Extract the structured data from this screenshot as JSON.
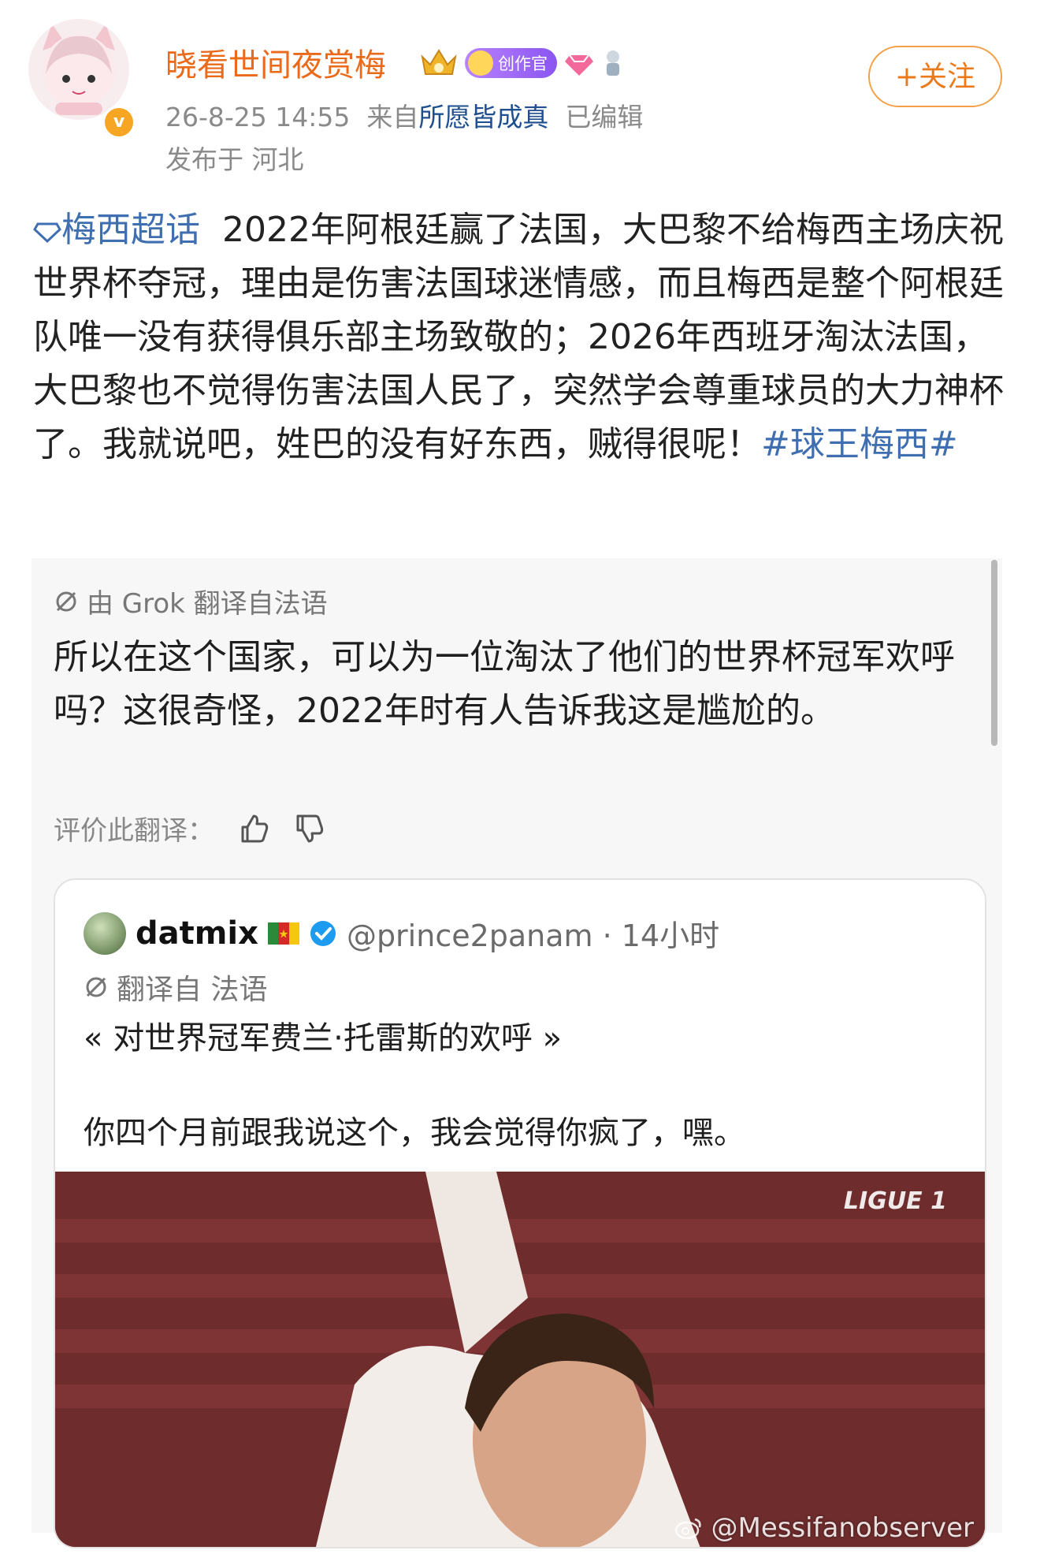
{
  "user": {
    "name": "晓看世间夜赏梅",
    "creator_badge": "创作官",
    "timestamp": "26-8-25 14:55",
    "source_prefix": "来自",
    "source": "所愿皆成真",
    "edited": "已编辑",
    "location": "发布于 河北"
  },
  "follow_button": "+关注",
  "post": {
    "topic": "梅西超话",
    "text": "2022年阿根廷赢了法国，大巴黎不给梅西主场庆祝世界杯夺冠，理由是伤害法国球迷情感，而且梅西是整个阿根廷队唯一没有获得俱乐部主场致敬的；2026年西班牙淘汰法国，大巴黎也不觉得伤害法国人民了，突然学会尊重球员的大力神杯了。我就说吧，姓巴的没有好东西，贼得很呢！",
    "hashtag": "#球王梅西#"
  },
  "translation": {
    "label": "由 Grok 翻译自法语",
    "text": "所以在这个国家，可以为一位淘汰了他们的世界杯冠军欢呼吗？这很奇怪，2022年时有人告诉我这是尴尬的。",
    "rate_label": "评价此翻译："
  },
  "quote": {
    "name": "datmix",
    "handle": "@prince2panam · 14小时",
    "translated_from": "翻译自 法语",
    "line1": "« 对世界冠军费兰·托雷斯的欢呼 »",
    "line2": "你四个月前跟我说这个，我会觉得你疯了，嘿。",
    "image_logo": "LIGUE 1",
    "watermark": "@Messifanobserver"
  },
  "colors": {
    "username": "#ea6a1a",
    "link": "#3f6fb0",
    "verified": "#1d9bf0"
  },
  "icons": [
    "crown-badge-icon",
    "creator-badge-icon",
    "diamond-badge-icon",
    "mascot-icon",
    "topic-diamond-icon",
    "grok-icon",
    "thumbs-up-icon",
    "thumbs-down-icon",
    "cameroon-flag-icon",
    "verified-icon",
    "weibo-icon"
  ]
}
